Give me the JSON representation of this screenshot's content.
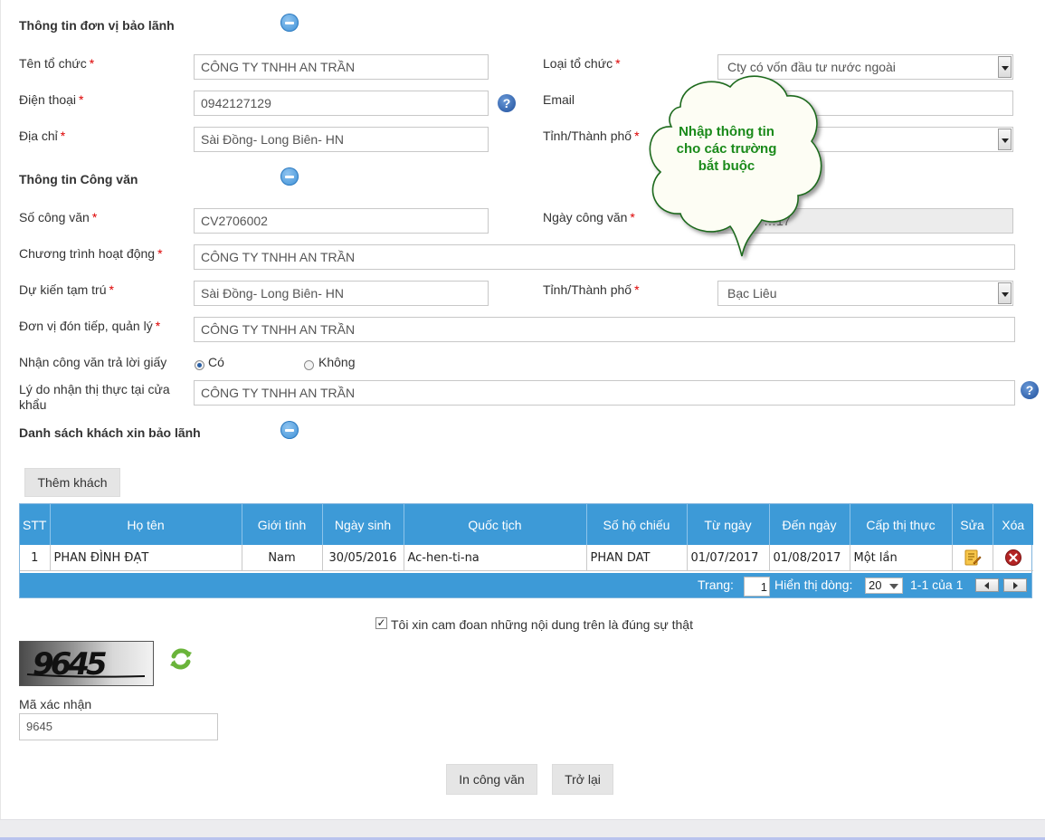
{
  "sections": {
    "org_info": "Thông tin đơn vị bảo lãnh",
    "doc_info": "Thông tin Công văn",
    "guest_list": "Danh sách khách xin bảo lãnh"
  },
  "fields": {
    "org_name_label": "Tên tổ chức",
    "org_name_value": "CÔNG TY TNHH AN TRẦN",
    "org_type_label": "Loại tổ chức",
    "org_type_value": "Cty có vốn đầu tư nước ngoài",
    "phone_label": "Điện thoại",
    "phone_value": "0942127129",
    "email_label": "Email",
    "email_value": "",
    "address_label": "Địa chỉ",
    "address_value": "Sài Đồng- Long Biên- HN",
    "province_label": "Tỉnh/Thành phố",
    "province_value": "",
    "doc_no_label": "Số công văn",
    "doc_no_value": "CV2706002",
    "doc_date_label": "Ngày công văn",
    "doc_date_value": "…17",
    "program_label": "Chương trình hoạt động",
    "program_value": "CÔNG TY TNHH AN TRẦN",
    "stay_label": "Dự kiến tạm trú",
    "stay_value": "Sài Đồng- Long Biên- HN",
    "stay_province_label": "Tỉnh/Thành phố",
    "stay_province_value": "Bạc Liêu",
    "host_label": "Đơn vị đón tiếp, quản lý",
    "host_value": "CÔNG TY TNHH AN TRẦN",
    "reply_label": "Nhận công văn trả lời giấy",
    "reply_yes": "Có",
    "reply_no": "Không",
    "visa_reason_label_1": "Lý do nhận thị thực tại cửa",
    "visa_reason_label_2": "khẩu",
    "visa_reason_value": "CÔNG TY TNHH AN TRẦN",
    "required_mark": "*",
    "help_mark": "?"
  },
  "tooltip": {
    "line1": "Nhập thông tin",
    "line2": "cho các trường",
    "line3": "bắt buộc"
  },
  "add_guest_button": "Thêm khách",
  "table": {
    "headers": [
      "STT",
      "Họ tên",
      "Giới tính",
      "Ngày sinh",
      "Quốc tịch",
      "Số hộ chiếu",
      "Từ ngày",
      "Đến ngày",
      "Cấp thị thực",
      "Sửa",
      "Xóa"
    ],
    "rows": [
      {
        "stt": "1",
        "name": "PHAN ĐÌNH ĐẠT",
        "gender": "Nam",
        "dob": "30/05/2016",
        "nationality": "Ac-hen-ti-na",
        "passport": "PHAN DAT",
        "from": "01/07/2017",
        "to": "01/08/2017",
        "visa": "Một lần"
      }
    ]
  },
  "pager": {
    "page_label": "Trang:",
    "page_value": "1",
    "rows_label": "Hiển thị dòng:",
    "rows_value": "20",
    "range": "1-1 của 1"
  },
  "commit_text": "Tôi xin cam đoan những nội dung trên là đúng sự thật",
  "captcha": {
    "image_text": "9645",
    "label": "Mã xác nhận",
    "value": "9645"
  },
  "buttons": {
    "print": "In công văn",
    "back": "Trở lại"
  }
}
